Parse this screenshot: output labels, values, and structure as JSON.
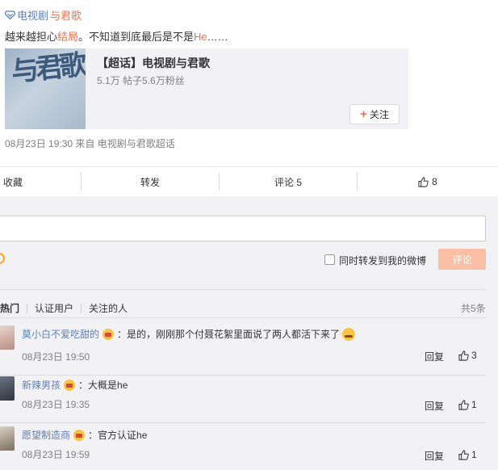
{
  "post": {
    "topic_icon": "super-topic-icon",
    "topic_prefix": "电视剧",
    "topic_highlight": "与君歌",
    "text_part1": "越来越担心",
    "text_link1": "结局",
    "text_part2": "。不知道到底最后是不是",
    "text_link2": "He",
    "text_part3": "……",
    "card": {
      "thumb_text": "与君歌",
      "title": "【超话】电视剧与君歌",
      "stats": "5.1万 帖子5.6万粉丝",
      "follow_label": "关注"
    },
    "meta": "08月23日 19:30  来自 电视剧与君歌超话"
  },
  "actions": {
    "favorite": "收藏",
    "repost": "转发",
    "comment": "评论 5",
    "like_count": "8"
  },
  "composer": {
    "input_placeholder": "",
    "repost_checkbox_label": "同时转发到我的微博",
    "submit_label": "评论"
  },
  "comment_tabs": {
    "tabs": [
      "热门",
      "认证用户",
      "关注的人"
    ],
    "total": "共5条"
  },
  "comments": [
    {
      "user": "莫小白不爱吃甜的",
      "text": "：是的，刚刚那个付聂花絮里面说了两人都活下来了",
      "time": "08月23日 19:50",
      "reply": "回复",
      "likes": "3"
    },
    {
      "user": "新辣男孩",
      "text": "：大概是he",
      "time": "08月23日 19:35",
      "reply": "回复",
      "likes": "1"
    },
    {
      "user": "愿望制造商",
      "text": "：官方认证he",
      "time": "08月23日 19:59",
      "reply": "回复",
      "likes": "1"
    }
  ],
  "colors": {
    "accent": "#eb7350",
    "link_blue": "#5d7fbb",
    "panel_bg": "#f2f2f5",
    "submit_disabled": "#fbbfa5"
  }
}
